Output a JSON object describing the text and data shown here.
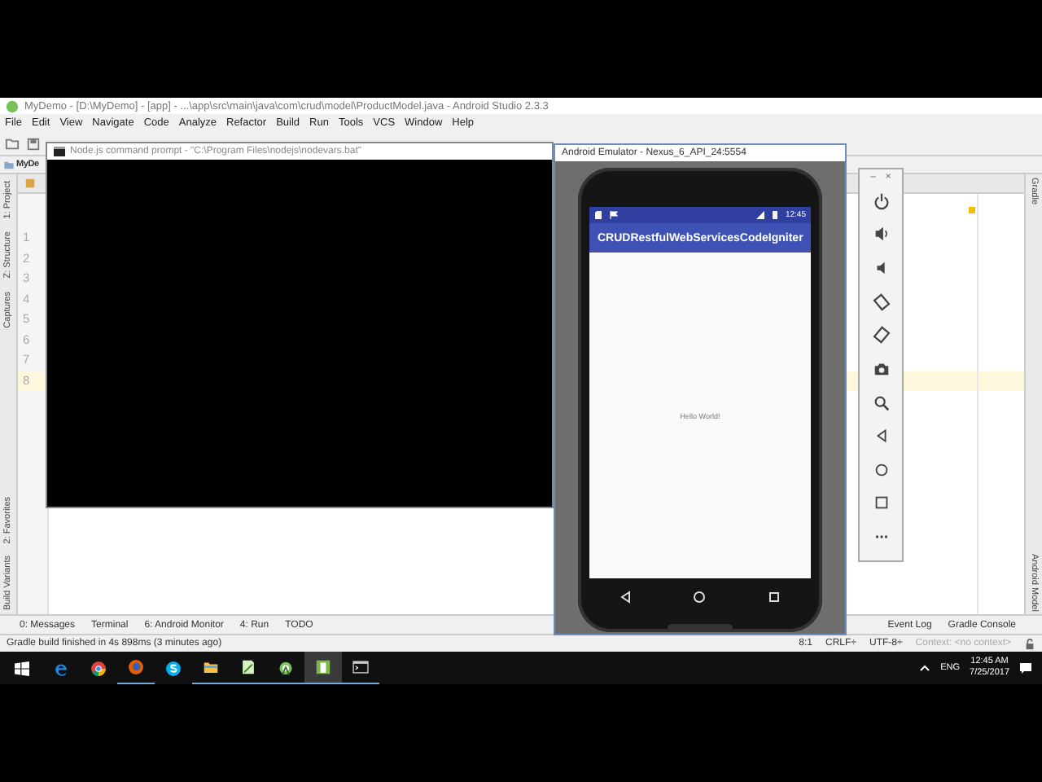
{
  "ide": {
    "title": "MyDemo - [D:\\MyDemo] - [app] - ...\\app\\src\\main\\java\\com\\crud\\model\\ProductModel.java - Android Studio 2.3.3",
    "menu": [
      "File",
      "Edit",
      "View",
      "Navigate",
      "Code",
      "Analyze",
      "Refactor",
      "Build",
      "Run",
      "Tools",
      "VCS",
      "Window",
      "Help"
    ],
    "breadcrumb": "MyDe",
    "left_tool_tabs": [
      "1: Project",
      "Z: Structure",
      "Captures",
      "2: Favorites",
      "Build Variants"
    ],
    "right_tool_tabs": [
      "Gradle",
      "Android Model"
    ],
    "line_numbers": [
      {
        "text": "1",
        "selected": false
      },
      {
        "text": "2",
        "selected": false
      },
      {
        "text": "3",
        "selected": false
      },
      {
        "text": "4",
        "selected": false
      },
      {
        "text": "5",
        "selected": false
      },
      {
        "text": "6",
        "selected": false
      },
      {
        "text": "7",
        "selected": false
      },
      {
        "text": "8",
        "selected": true
      }
    ],
    "bottom_tabs": [
      "0: Messages",
      "Terminal",
      "6: Android Monitor",
      "4: Run",
      "TODO"
    ],
    "bottom_right_tabs": [
      "Event Log",
      "Gradle Console"
    ],
    "status_bar": {
      "message": "Gradle build finished in 4s 898ms (3 minutes ago)",
      "position": "8:1",
      "line_separator": "CRLF÷",
      "encoding": "UTF-8÷",
      "context": "Context: <no context>"
    }
  },
  "node_window": {
    "title": "Node.js command prompt - \"C:\\Program Files\\nodejs\\nodevars.bat\""
  },
  "emulator": {
    "title": "Android Emulator - Nexus_6_API_24:5554",
    "clock": "12:45",
    "app_title": "CRUDRestfulWebServicesCodeIgniter",
    "body_text": "Hello World!"
  },
  "emulator_toolbar": {
    "minimize": "–",
    "close": "×",
    "tools": [
      {
        "kind": "power"
      },
      {
        "kind": "volume-up"
      },
      {
        "kind": "volume-down"
      },
      {
        "kind": "rotate-left"
      },
      {
        "kind": "rotate-right"
      },
      {
        "kind": "camera"
      },
      {
        "kind": "zoom"
      },
      {
        "kind": "back"
      },
      {
        "kind": "home"
      },
      {
        "kind": "overview"
      },
      {
        "kind": "more"
      }
    ]
  },
  "taskbar": {
    "apps": [
      {
        "kind": "edge",
        "running": false,
        "selected": false
      },
      {
        "kind": "chrome",
        "running": false,
        "selected": false
      },
      {
        "kind": "firefox",
        "running": true,
        "selected": false
      },
      {
        "kind": "skype",
        "running": false,
        "selected": false
      },
      {
        "kind": "explorer",
        "running": true,
        "selected": false
      },
      {
        "kind": "notepad",
        "running": true,
        "selected": false
      },
      {
        "kind": "android-studio",
        "running": true,
        "selected": false
      },
      {
        "kind": "green-app",
        "running": true,
        "selected": true
      },
      {
        "kind": "terminal",
        "running": true,
        "selected": false
      }
    ],
    "language": "ENG",
    "time": "12:45 AM",
    "date": "7/25/2017"
  }
}
